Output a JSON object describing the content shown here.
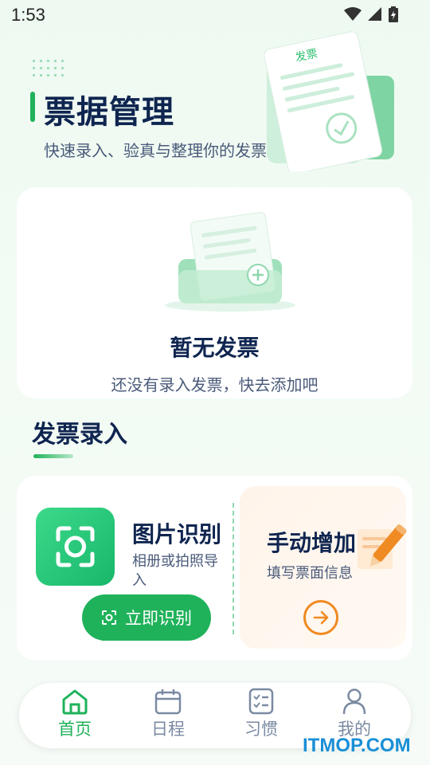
{
  "status_bar": {
    "time": "1:53"
  },
  "header": {
    "title": "票据管理",
    "subtitle": "快速录入、验真与整理你的发票",
    "illustration_label": "发票"
  },
  "empty_state": {
    "title": "暂无发票",
    "description": "还没有录入发票，快去添加吧"
  },
  "section": {
    "title": "发票录入"
  },
  "image_recognition": {
    "title": "图片识别",
    "description": "相册或拍照导入",
    "button_label": "立即识别"
  },
  "manual_add": {
    "title": "手动增加",
    "description": "填写票面信息"
  },
  "bottom_nav": {
    "items": [
      {
        "label": "首页",
        "icon": "home-icon",
        "active": true
      },
      {
        "label": "日程",
        "icon": "calendar-icon",
        "active": false
      },
      {
        "label": "习惯",
        "icon": "checklist-icon",
        "active": false
      },
      {
        "label": "我的",
        "icon": "person-icon",
        "active": false
      }
    ]
  },
  "watermark": "ITMOP.COM",
  "colors": {
    "accent": "#1fb25a",
    "title": "#0f2550",
    "orange": "#f08a22"
  }
}
